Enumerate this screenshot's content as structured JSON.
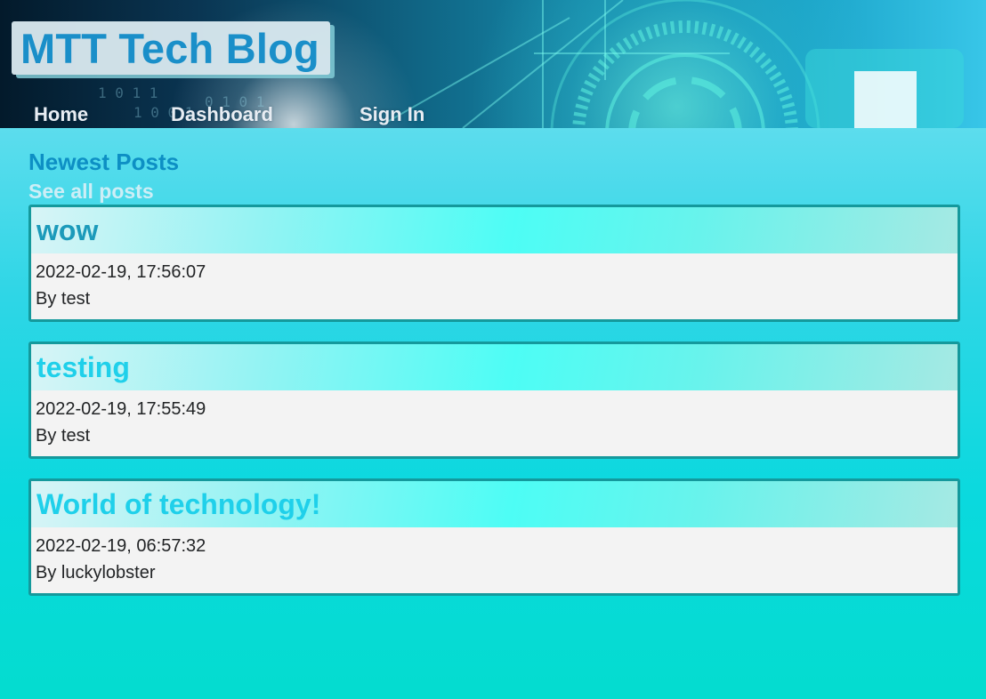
{
  "header": {
    "site_title": "MTT Tech Blog",
    "nav": {
      "home": "Home",
      "dashboard": "Dashboard",
      "sign_in": "Sign In"
    }
  },
  "main": {
    "section_title": "Newest Posts",
    "see_all_link": "See all posts",
    "posts": [
      {
        "title": "wow",
        "date": "2022-02-19, 17:56:07",
        "author": "By test"
      },
      {
        "title": "testing",
        "date": "2022-02-19, 17:55:49",
        "author": "By test"
      },
      {
        "title": "World of technology!",
        "date": "2022-02-19, 06:57:32",
        "author": "By luckylobster"
      }
    ]
  },
  "colors": {
    "brand_blue": "#1a8fc9",
    "post_title": "#1fd0ea",
    "card_border": "#14999c"
  }
}
